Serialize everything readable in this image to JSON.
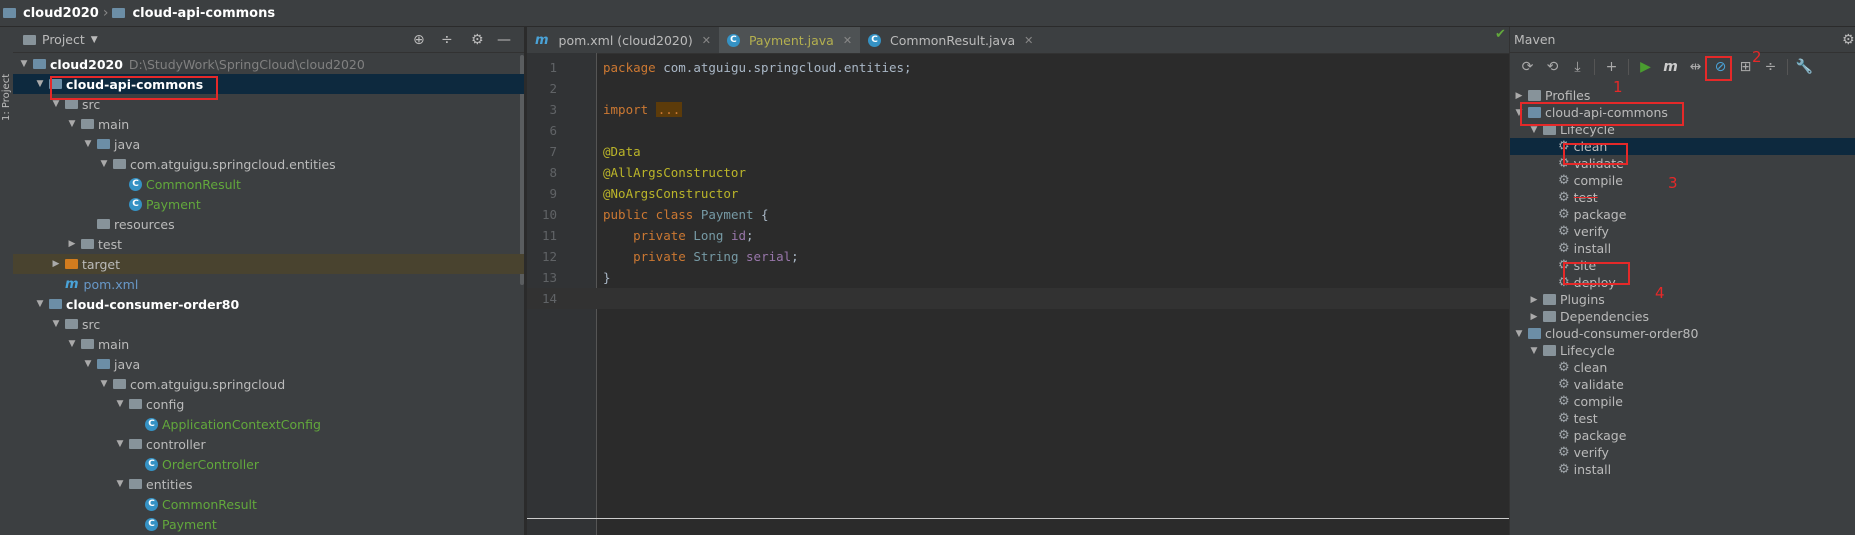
{
  "breadcrumb": [
    "cloud2020",
    "cloud-api-commons"
  ],
  "left_strip_label": "1: Project",
  "project": {
    "title": "Project",
    "root_name": "cloud2020",
    "root_path": "D:\\StudyWork\\SpringCloud\\cloud2020",
    "tree": [
      {
        "label": "cloud-api-commons",
        "depth": 1,
        "arrow": "open",
        "icon": "module",
        "style": "bold",
        "selected": true
      },
      {
        "label": "src",
        "depth": 2,
        "arrow": "open",
        "icon": "folder"
      },
      {
        "label": "main",
        "depth": 3,
        "arrow": "open",
        "icon": "folder"
      },
      {
        "label": "java",
        "depth": 4,
        "arrow": "open",
        "icon": "folder-blue"
      },
      {
        "label": "com.atguigu.springcloud.entities",
        "depth": 5,
        "arrow": "open",
        "icon": "folder"
      },
      {
        "label": "CommonResult",
        "depth": 6,
        "arrow": "none",
        "icon": "class",
        "style": "green"
      },
      {
        "label": "Payment",
        "depth": 6,
        "arrow": "none",
        "icon": "class",
        "style": "green"
      },
      {
        "label": "resources",
        "depth": 4,
        "arrow": "none",
        "icon": "folder-res"
      },
      {
        "label": "test",
        "depth": 3,
        "arrow": "closed",
        "icon": "folder"
      },
      {
        "label": "target",
        "depth": 2,
        "arrow": "closed",
        "icon": "folder-orange",
        "excluded": true
      },
      {
        "label": "pom.xml",
        "depth": 2,
        "arrow": "none",
        "icon": "maven",
        "style": "blue"
      },
      {
        "label": "cloud-consumer-order80",
        "depth": 1,
        "arrow": "open",
        "icon": "module",
        "style": "bold"
      },
      {
        "label": "src",
        "depth": 2,
        "arrow": "open",
        "icon": "folder"
      },
      {
        "label": "main",
        "depth": 3,
        "arrow": "open",
        "icon": "folder"
      },
      {
        "label": "java",
        "depth": 4,
        "arrow": "open",
        "icon": "folder-blue"
      },
      {
        "label": "com.atguigu.springcloud",
        "depth": 5,
        "arrow": "open",
        "icon": "folder"
      },
      {
        "label": "config",
        "depth": 6,
        "arrow": "open",
        "icon": "folder"
      },
      {
        "label": "ApplicationContextConfig",
        "depth": 7,
        "arrow": "none",
        "icon": "class",
        "style": "green"
      },
      {
        "label": "controller",
        "depth": 6,
        "arrow": "open",
        "icon": "folder"
      },
      {
        "label": "OrderController",
        "depth": 7,
        "arrow": "none",
        "icon": "class",
        "style": "green"
      },
      {
        "label": "entities",
        "depth": 6,
        "arrow": "open",
        "icon": "folder"
      },
      {
        "label": "CommonResult",
        "depth": 7,
        "arrow": "none",
        "icon": "class",
        "style": "green"
      },
      {
        "label": "Payment",
        "depth": 7,
        "arrow": "none",
        "icon": "class",
        "style": "green"
      }
    ]
  },
  "editor": {
    "tabs": [
      {
        "label": "pom.xml (cloud2020)",
        "icon": "m",
        "active": false
      },
      {
        "label": "Payment.java",
        "icon": "C",
        "active": true
      },
      {
        "label": "CommonResult.java",
        "icon": "C",
        "active": false
      }
    ],
    "lines": [
      {
        "n": "1",
        "segs": [
          [
            "kw",
            "package "
          ],
          [
            "txt",
            "com.atguigu.springcloud.entities;"
          ]
        ]
      },
      {
        "n": "2",
        "segs": []
      },
      {
        "n": "3",
        "segs": [
          [
            "kw",
            "import "
          ],
          [
            "fold",
            "..."
          ]
        ]
      },
      {
        "n": "6",
        "segs": []
      },
      {
        "n": "7",
        "segs": [
          [
            "ann",
            "@Data"
          ]
        ]
      },
      {
        "n": "8",
        "segs": [
          [
            "ann",
            "@AllArgsConstructor"
          ]
        ]
      },
      {
        "n": "9",
        "segs": [
          [
            "ann",
            "@NoArgsConstructor"
          ]
        ]
      },
      {
        "n": "10",
        "segs": [
          [
            "kw",
            "public class "
          ],
          [
            "cls",
            "Payment"
          ],
          [
            "txt",
            " {"
          ]
        ]
      },
      {
        "n": "11",
        "segs": [
          [
            "txt",
            "    "
          ],
          [
            "kw",
            "private "
          ],
          [
            "cls",
            "Long "
          ],
          [
            "fld",
            "id"
          ],
          [
            "txt",
            ";"
          ]
        ]
      },
      {
        "n": "12",
        "segs": [
          [
            "txt",
            "    "
          ],
          [
            "kw",
            "private "
          ],
          [
            "cls",
            "String "
          ],
          [
            "fld",
            "serial"
          ],
          [
            "txt",
            ";"
          ]
        ]
      },
      {
        "n": "13",
        "segs": [
          [
            "txt",
            "}"
          ]
        ]
      },
      {
        "n": "14",
        "segs": [],
        "current": true
      }
    ]
  },
  "maven": {
    "title": "Maven",
    "tree": [
      {
        "label": "Profiles",
        "depth": 0,
        "arrow": "closed",
        "icon": "profiles"
      },
      {
        "label": "cloud-api-commons",
        "depth": 0,
        "arrow": "open",
        "icon": "maven-module"
      },
      {
        "label": "Lifecycle",
        "depth": 1,
        "arrow": "open",
        "icon": "lifecycle"
      },
      {
        "label": "clean",
        "depth": 2,
        "icon": "gear",
        "selected": true
      },
      {
        "label": "validate",
        "depth": 2,
        "icon": "gear"
      },
      {
        "label": "compile",
        "depth": 2,
        "icon": "gear"
      },
      {
        "label": "test",
        "depth": 2,
        "icon": "gear",
        "strike": true
      },
      {
        "label": "package",
        "depth": 2,
        "icon": "gear"
      },
      {
        "label": "verify",
        "depth": 2,
        "icon": "gear"
      },
      {
        "label": "install",
        "depth": 2,
        "icon": "gear"
      },
      {
        "label": "site",
        "depth": 2,
        "icon": "gear"
      },
      {
        "label": "deploy",
        "depth": 2,
        "icon": "gear"
      },
      {
        "label": "Plugins",
        "depth": 1,
        "arrow": "closed",
        "icon": "lifecycle"
      },
      {
        "label": "Dependencies",
        "depth": 1,
        "arrow": "closed",
        "icon": "lifecycle"
      },
      {
        "label": "cloud-consumer-order80",
        "depth": 0,
        "arrow": "open",
        "icon": "maven-module"
      },
      {
        "label": "Lifecycle",
        "depth": 1,
        "arrow": "open",
        "icon": "lifecycle"
      },
      {
        "label": "clean",
        "depth": 2,
        "icon": "gear"
      },
      {
        "label": "validate",
        "depth": 2,
        "icon": "gear"
      },
      {
        "label": "compile",
        "depth": 2,
        "icon": "gear"
      },
      {
        "label": "test",
        "depth": 2,
        "icon": "gear"
      },
      {
        "label": "package",
        "depth": 2,
        "icon": "gear"
      },
      {
        "label": "verify",
        "depth": 2,
        "icon": "gear"
      },
      {
        "label": "install",
        "depth": 2,
        "icon": "gear"
      }
    ],
    "annotations": [
      "1",
      "2",
      "3",
      "4"
    ]
  }
}
